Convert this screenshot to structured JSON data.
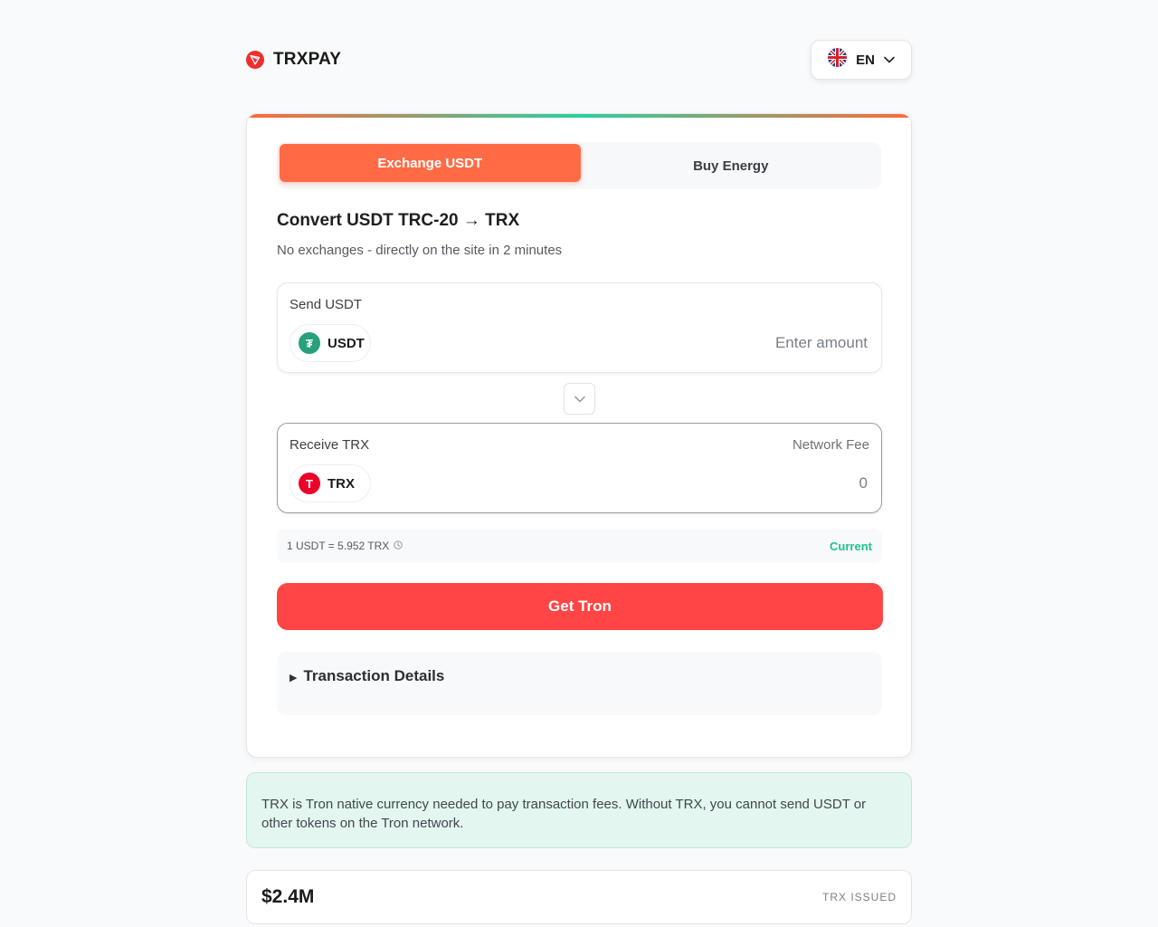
{
  "header": {
    "brand_name": "TRXPAY",
    "language": {
      "code": "EN",
      "flag": "uk-flag-icon"
    }
  },
  "tabs": [
    {
      "label": "Exchange USDT",
      "active": true
    },
    {
      "label": "Buy Energy",
      "active": false
    }
  ],
  "converter": {
    "title": "Convert USDT TRC-20 → TRX",
    "subtitle": "No exchanges - directly on the site in 2 minutes",
    "send": {
      "label": "Send USDT",
      "token": "USDT",
      "token_symbol": "₮",
      "placeholder": "Enter amount",
      "value": ""
    },
    "receive": {
      "label": "Receive TRX",
      "fee_label": "Network Fee",
      "token": "TRX",
      "token_symbol": "T",
      "value": "0"
    },
    "rate": {
      "text": "1 USDT = 5.952 TRX",
      "status": "Current"
    },
    "cta_label": "Get Tron",
    "details_label": "Transaction Details"
  },
  "info_text": "TRX is Tron native currency needed to pay transaction fees. Without TRX, you cannot send USDT or other tokens on the Tron network.",
  "stats": {
    "value": "$2.4M",
    "label": "TRX ISSUED"
  },
  "colors": {
    "accent_orange": "#ff6b45",
    "cta_red": "#ff4545",
    "status_green": "#1fc389",
    "usdt_green": "#26a17b",
    "trx_red": "#eb0029"
  }
}
